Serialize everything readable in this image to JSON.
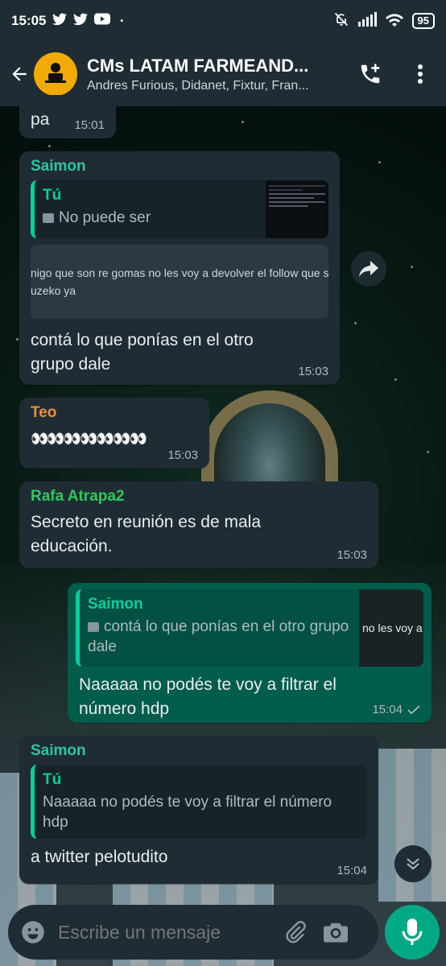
{
  "status_bar": {
    "time": "15:05",
    "battery": "95"
  },
  "header": {
    "title": "CMs LATAM FARMEAND...",
    "subtitle": "Andres Furious, Didanet, Fixtur, Fran..."
  },
  "colors": {
    "header_bg": "#1f2c34",
    "incoming_bubble": "#1f2c34",
    "outgoing_bubble": "#005c4b",
    "accent": "#00a884",
    "quote_bar": "#06cf9c"
  },
  "messages": [
    {
      "text": "pa",
      "time": "15:01"
    },
    {
      "sender": "Saimon",
      "sender_color": "#2ec4a6",
      "quote": {
        "name": "Tú",
        "text": "No puede ser"
      },
      "preview_lines": [
        "nigo que son re gomas no les voy a devolver el follow que s",
        "uzeko ya"
      ],
      "text": "contá lo que ponías en el otro grupo dale",
      "time": "15:03"
    },
    {
      "sender": "Teo",
      "sender_color": "#e8923a",
      "text": "👀👀👀👀👀👀👀",
      "time": "15:03"
    },
    {
      "sender": "Rafa Atrapa2",
      "sender_color": "#30c75e",
      "text": "Secreto en reunión es de mala educación.",
      "time": "15:03"
    },
    {
      "outgoing": true,
      "quote": {
        "name": "Saimon",
        "text": "contá lo que ponías en el otro grupo dale",
        "thumb_text": "no les voy a"
      },
      "text": "Naaaaa no podés te voy a filtrar el número hdp",
      "time": "15:04"
    },
    {
      "sender": "Saimon",
      "sender_color": "#2ec4a6",
      "quote": {
        "name": "Tú",
        "text": "Naaaaa no podés te voy a filtrar el número hdp"
      },
      "text": "a twitter pelotudito",
      "time": "15:04"
    }
  ],
  "composer": {
    "placeholder": "Escribe un mensaje"
  },
  "icons": [
    "back-arrow-icon",
    "group-avatar-icon",
    "add-call-icon",
    "more-options-icon",
    "forward-icon",
    "scroll-down-icon",
    "emoji-icon",
    "attach-icon",
    "camera-icon",
    "mic-icon"
  ]
}
